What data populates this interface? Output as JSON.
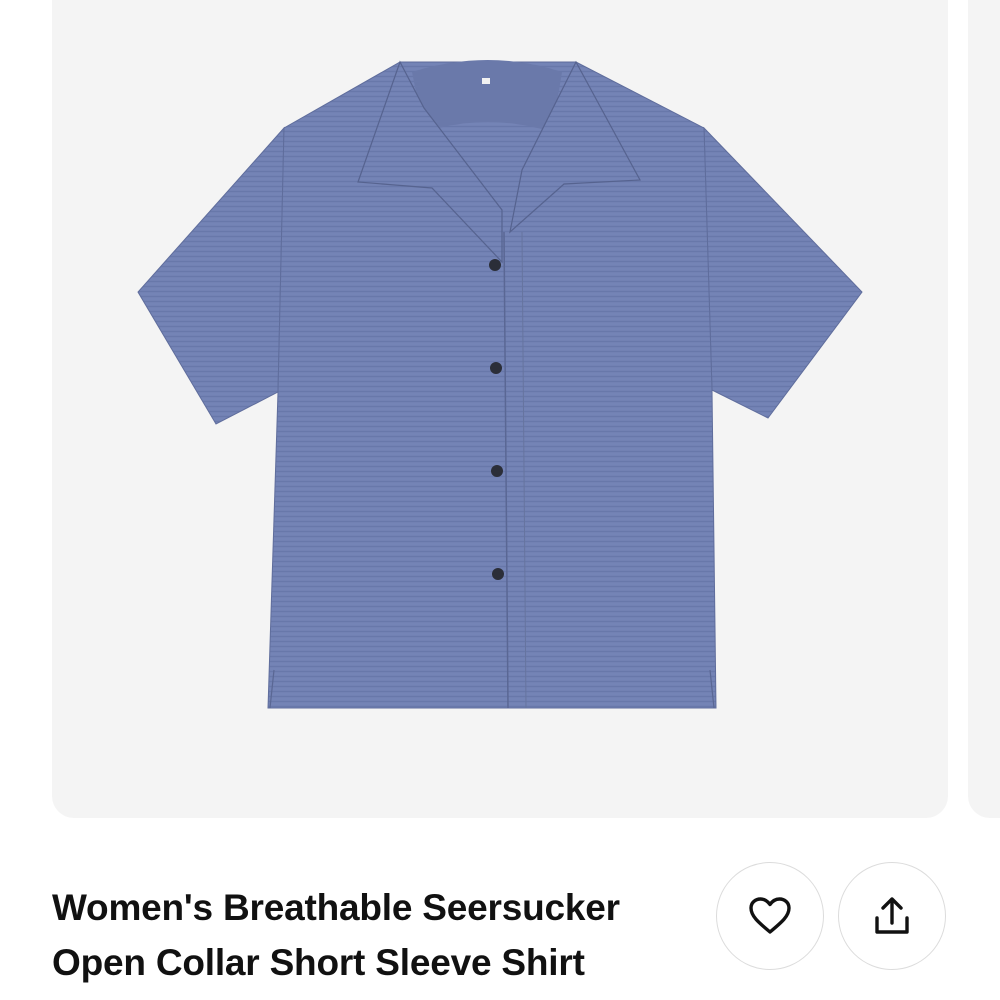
{
  "product": {
    "title": "Women's Breathable Seersucker Open Collar Short Sleeve Shirt",
    "image_color": "#7281b3",
    "button_color": "#2b2e38"
  },
  "actions": {
    "favorite_icon": "heart-icon",
    "share_icon": "share-upload-icon"
  },
  "colors": {
    "card_background": "#f4f4f4",
    "text": "#111111",
    "button_border": "#dcdcdc"
  }
}
